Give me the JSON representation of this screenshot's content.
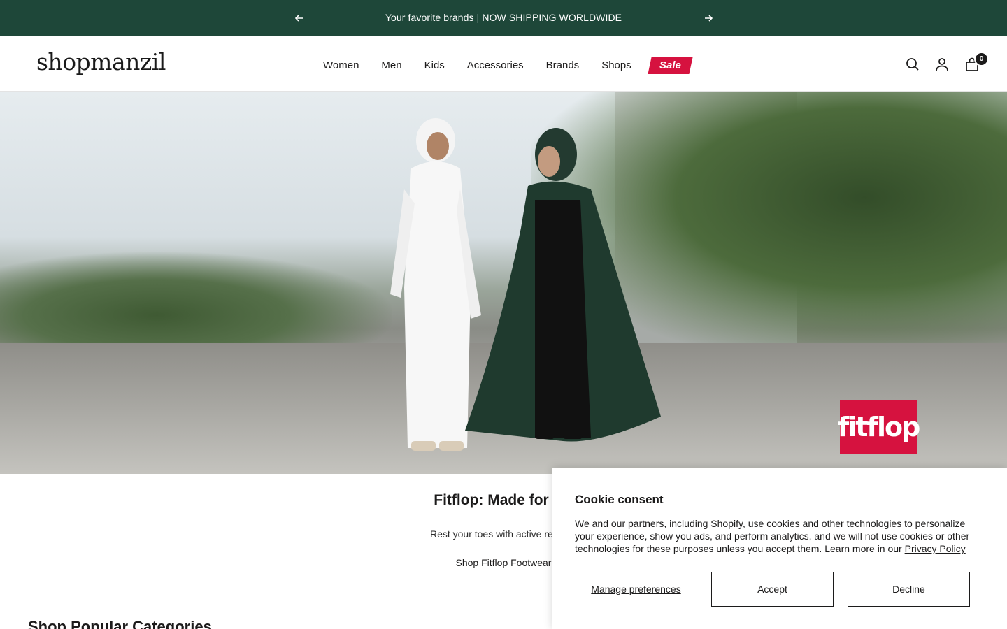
{
  "announcement": {
    "message": "Your favorite brands | NOW SHIPPING WORLDWIDE",
    "background": "#1e4739"
  },
  "header": {
    "logo": "shopmanzil",
    "nav": [
      "Women",
      "Men",
      "Kids",
      "Accessories",
      "Brands",
      "Shops"
    ],
    "sale_label": "Sale",
    "sale_color": "#d6123f",
    "cart_count": "0"
  },
  "hero": {
    "brand_logo": "fitflop",
    "title": "Fitflop: Made for livi",
    "subtitle": "Rest your toes with active recover",
    "link_label": "Shop Fitflop Footwear"
  },
  "section": {
    "title": "Shop Popular Categories"
  },
  "cookie": {
    "title": "Cookie consent",
    "body": "We and our partners, including Shopify, use cookies and other technologies to personalize your experience, show you ads, and perform analytics, and we will not use cookies or other technologies for these purposes unless you accept them. Learn more in our ",
    "privacy_link": "Privacy Policy",
    "manage_label": "Manage preferences",
    "accept_label": "Accept",
    "decline_label": "Decline"
  }
}
